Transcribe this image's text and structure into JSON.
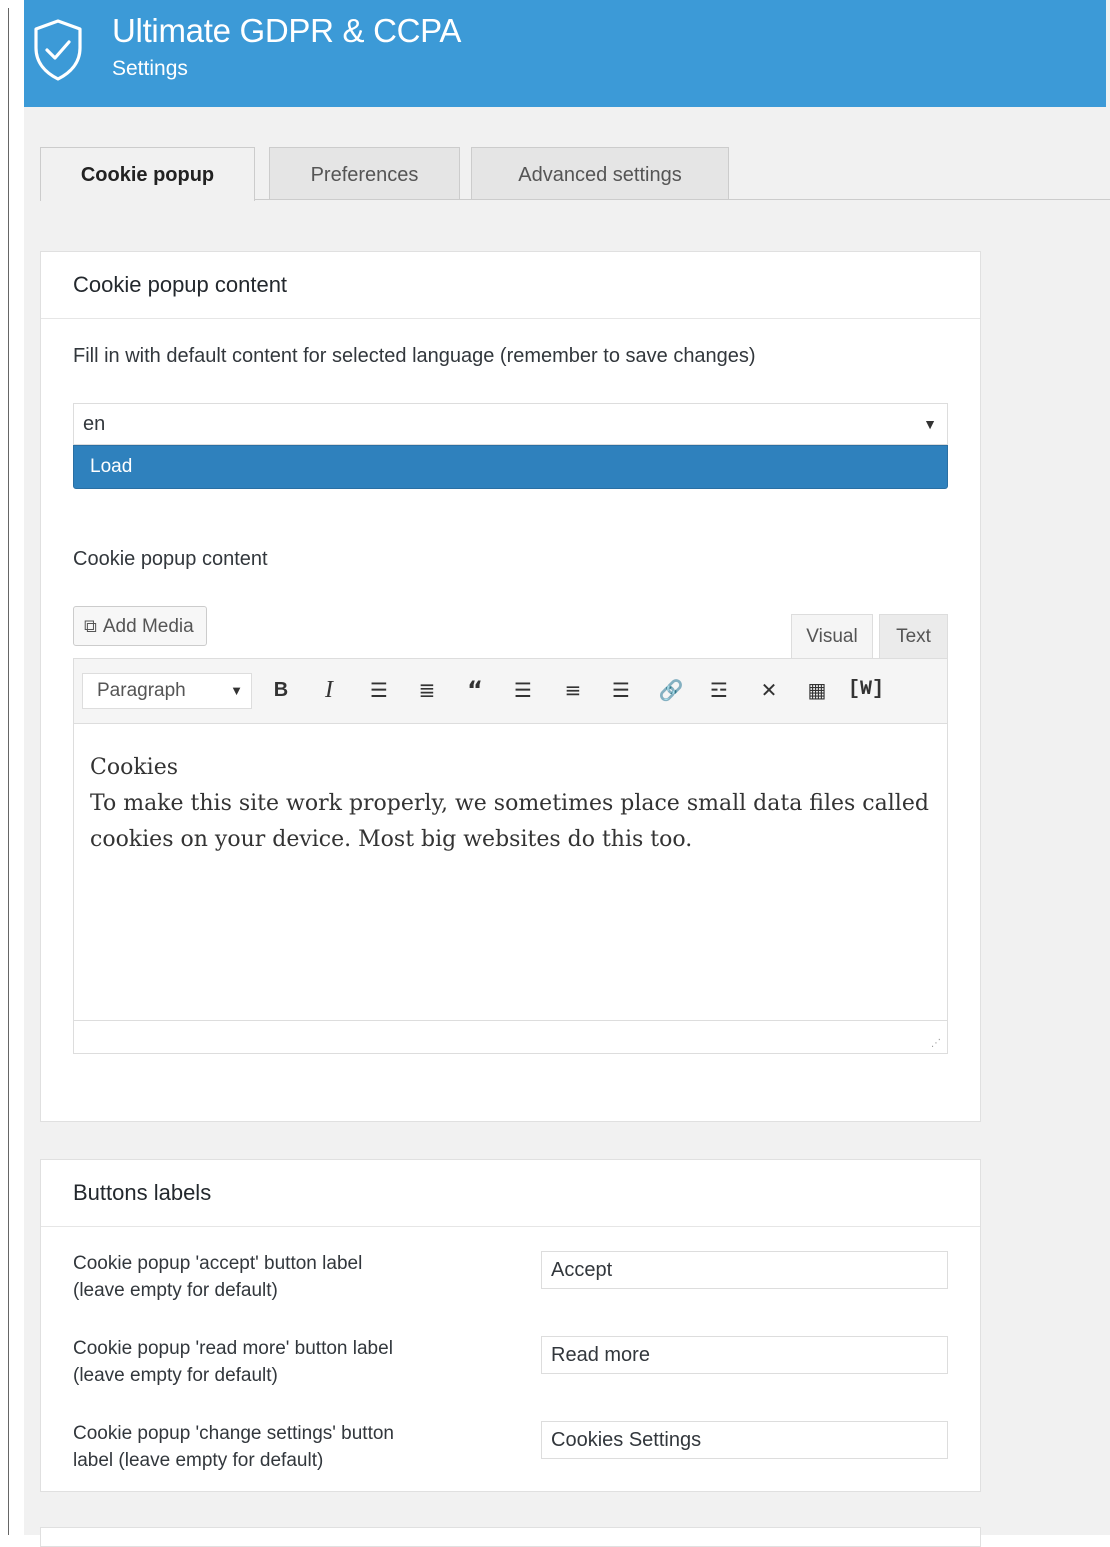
{
  "app": {
    "title": "Ultimate GDPR & CCPA",
    "subtitle": "Settings",
    "icon": "shield-check-icon",
    "brand_color": "#3c9ad7"
  },
  "tabs": [
    {
      "label": "Cookie popup",
      "active": true
    },
    {
      "label": "Preferences",
      "active": false
    },
    {
      "label": "Advanced settings",
      "active": false
    }
  ],
  "content_panel": {
    "heading": "Cookie popup content",
    "fill_hint": "Fill in with default content for selected language (remember to save changes)",
    "language_select": {
      "value": "en"
    },
    "load_label": "Load",
    "editor_label": "Cookie popup content",
    "add_media_label": "Add Media",
    "editor_tabs": {
      "visual": "Visual",
      "text": "Text"
    },
    "format_select": "Paragraph",
    "toolbar_icons": [
      "bold-icon",
      "italic-icon",
      "bullet-list-icon",
      "numbered-list-icon",
      "blockquote-icon",
      "align-left-icon",
      "align-center-icon",
      "align-right-icon",
      "link-icon",
      "read-more-icon",
      "fullscreen-icon",
      "toolbar-toggle-icon",
      "shortcode-icon"
    ],
    "body_title": "Cookies",
    "body_text": "To make this site work properly, we sometimes place small data files called cookies on your device. Most big websites do this too."
  },
  "buttons_panel": {
    "heading": "Buttons labels",
    "rows": [
      {
        "label_line1": "Cookie popup 'accept' button label",
        "label_line2": "(leave empty for default)",
        "value": "Accept"
      },
      {
        "label_line1": "Cookie popup 'read more' button label",
        "label_line2": "(leave empty for default)",
        "value": "Read more"
      },
      {
        "label_line1": "Cookie popup 'change settings' button",
        "label_line2": "label (leave empty for default)",
        "value": "Cookies Settings"
      }
    ]
  }
}
